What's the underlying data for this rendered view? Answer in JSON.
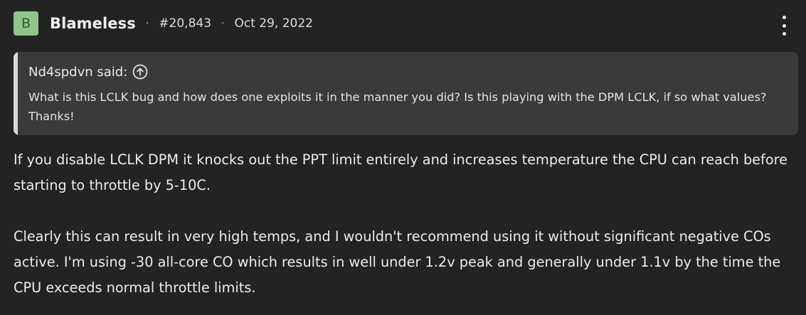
{
  "post": {
    "author": {
      "avatar_letter": "B",
      "name": "Blameless"
    },
    "separator": "·",
    "post_number": "#20,843",
    "date": "Oct 29, 2022",
    "menu_icon": "more-vertical-icon",
    "quote": {
      "author_line": "Nd4spdvn said:",
      "jump_icon": "arrow-up-circle-icon",
      "text": "What is this LCLK bug and how does one exploits it in the manner you did? Is this playing with the DPM LCLK, if so what values? Thanks!"
    },
    "paragraphs": [
      "If you disable LCLK DPM it knocks out the PPT limit entirely and increases temperature the CPU can reach before starting to throttle by 5-10C.",
      "Clearly this can result in very high temps, and I wouldn't recommend using it without significant negative COs active. I'm using -30 all-core CO which results in well under 1.2v peak and generally under 1.1v by the time the CPU exceeds normal throttle limits."
    ]
  },
  "colors": {
    "background": "#232323",
    "avatar_bg": "#8fc58d",
    "quote_bg": "#3a3a3a",
    "quote_bar": "#d9d9d9"
  }
}
